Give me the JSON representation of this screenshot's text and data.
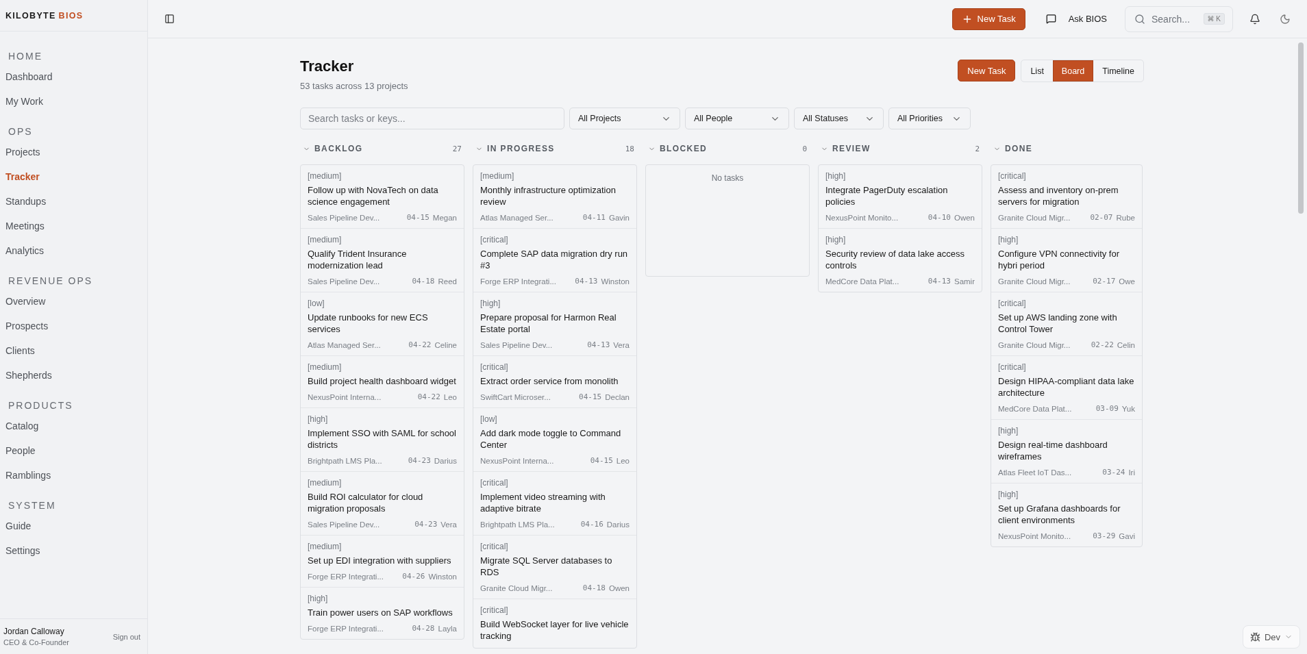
{
  "sidebar": {
    "logo": {
      "brand": "KILOBYTE",
      "product": "BIOS"
    },
    "sections": [
      {
        "heading": "HOME",
        "items": [
          {
            "label": "Dashboard",
            "selected": false
          },
          {
            "label": "My Work",
            "selected": false
          }
        ]
      },
      {
        "heading": "OPS",
        "items": [
          {
            "label": "Projects",
            "selected": false
          },
          {
            "label": "Tracker",
            "selected": true
          },
          {
            "label": "Standups",
            "selected": false
          },
          {
            "label": "Meetings",
            "selected": false
          },
          {
            "label": "Analytics",
            "selected": false
          }
        ]
      },
      {
        "heading": "REVENUE OPS",
        "items": [
          {
            "label": "Overview",
            "selected": false
          },
          {
            "label": "Prospects",
            "selected": false
          },
          {
            "label": "Clients",
            "selected": false
          },
          {
            "label": "Shepherds",
            "selected": false
          }
        ]
      },
      {
        "heading": "PRODUCTS",
        "items": [
          {
            "label": "Catalog",
            "selected": false
          },
          {
            "label": "People",
            "selected": false
          },
          {
            "label": "Ramblings",
            "selected": false
          }
        ]
      },
      {
        "heading": "SYSTEM",
        "items": [
          {
            "label": "Guide",
            "selected": false
          },
          {
            "label": "Settings",
            "selected": false
          }
        ]
      }
    ],
    "user": {
      "name": "Jordan Calloway",
      "role": "CEO & Co-Founder",
      "sign_out": "Sign out"
    }
  },
  "topbar": {
    "new_task": "New Task",
    "ask": "Ask BIOS",
    "search": {
      "placeholder": "Search...",
      "shortcut": "⌘ K"
    }
  },
  "page": {
    "title": "Tracker",
    "subtitle": "53 tasks across 13 projects",
    "new_task": "New Task",
    "views": [
      {
        "label": "List",
        "selected": false
      },
      {
        "label": "Board",
        "selected": true
      },
      {
        "label": "Timeline",
        "selected": false
      }
    ]
  },
  "filters": {
    "search": {
      "placeholder": "Search tasks or keys..."
    },
    "dropdowns": [
      "All Projects",
      "All People",
      "All Statuses",
      "All Priorities"
    ]
  },
  "board": {
    "columns": [
      {
        "title": "BACKLOG",
        "count": "27",
        "cards": [
          {
            "priority": "[medium]",
            "title": "Follow up with NovaTech on data science engagement",
            "project": "Sales Pipeline Dev...",
            "date": "04-15",
            "assignee": "Megan"
          },
          {
            "priority": "[medium]",
            "title": "Qualify Trident Insurance modernization lead",
            "project": "Sales Pipeline Dev...",
            "date": "04-18",
            "assignee": "Reed"
          },
          {
            "priority": "[low]",
            "title": "Update runbooks for new ECS services",
            "project": "Atlas Managed Ser...",
            "date": "04-22",
            "assignee": "Celine"
          },
          {
            "priority": "[medium]",
            "title": "Build project health dashboard widget",
            "project": "NexusPoint Interna...",
            "date": "04-22",
            "assignee": "Leo"
          },
          {
            "priority": "[high]",
            "title": "Implement SSO with SAML for school districts",
            "project": "Brightpath LMS Pla...",
            "date": "04-23",
            "assignee": "Darius"
          },
          {
            "priority": "[medium]",
            "title": "Build ROI calculator for cloud migration proposals",
            "project": "Sales Pipeline Dev...",
            "date": "04-23",
            "assignee": "Vera"
          },
          {
            "priority": "[medium]",
            "title": "Set up EDI integration with suppliers",
            "project": "Forge ERP Integrati...",
            "date": "04-26",
            "assignee": "Winston"
          },
          {
            "priority": "[high]",
            "title": "Train power users on SAP workflows",
            "project": "Forge ERP Integrati...",
            "date": "04-28",
            "assignee": "Layla"
          }
        ]
      },
      {
        "title": "IN PROGRESS",
        "count": "18",
        "cards": [
          {
            "priority": "[medium]",
            "title": "Monthly infrastructure optimization review",
            "project": "Atlas Managed Ser...",
            "date": "04-11",
            "assignee": "Gavin"
          },
          {
            "priority": "[critical]",
            "title": "Complete SAP data migration dry run #3",
            "project": "Forge ERP Integrati...",
            "date": "04-13",
            "assignee": "Winston"
          },
          {
            "priority": "[high]",
            "title": "Prepare proposal for Harmon Real Estate portal",
            "project": "Sales Pipeline Dev...",
            "date": "04-13",
            "assignee": "Vera"
          },
          {
            "priority": "[critical]",
            "title": "Extract order service from monolith",
            "project": "SwiftCart Microser...",
            "date": "04-15",
            "assignee": "Declan"
          },
          {
            "priority": "[low]",
            "title": "Add dark mode toggle to Command Center",
            "project": "NexusPoint Interna...",
            "date": "04-15",
            "assignee": "Leo"
          },
          {
            "priority": "[critical]",
            "title": "Implement video streaming with adaptive bitrate",
            "project": "Brightpath LMS Pla...",
            "date": "04-16",
            "assignee": "Darius"
          },
          {
            "priority": "[critical]",
            "title": "Migrate SQL Server databases to RDS",
            "project": "Granite Cloud Migr...",
            "date": "04-18",
            "assignee": "Owen"
          },
          {
            "priority": "[critical]",
            "title": "Build WebSocket layer for live vehicle tracking"
          }
        ]
      },
      {
        "title": "BLOCKED",
        "count": "0",
        "empty": "No tasks"
      },
      {
        "title": "REVIEW",
        "count": "2",
        "cards": [
          {
            "priority": "[high]",
            "title": "Integrate PagerDuty escalation policies",
            "project": "NexusPoint Monito...",
            "date": "04-10",
            "assignee": "Owen"
          },
          {
            "priority": "[high]",
            "title": "Security review of data lake access controls",
            "project": "MedCore Data Plat...",
            "date": "04-13",
            "assignee": "Samir"
          }
        ]
      },
      {
        "title": "DONE",
        "cards": [
          {
            "priority": "[critical]",
            "title": "Assess and inventory on-prem servers for migration",
            "project": "Granite Cloud Migr...",
            "date": "02-07",
            "assignee": "Rube"
          },
          {
            "priority": "[high]",
            "title": "Configure VPN connectivity for hybri period",
            "project": "Granite Cloud Migr...",
            "date": "02-17",
            "assignee": "Owe"
          },
          {
            "priority": "[critical]",
            "title": "Set up AWS landing zone with Control Tower",
            "project": "Granite Cloud Migr...",
            "date": "02-22",
            "assignee": "Celin"
          },
          {
            "priority": "[critical]",
            "title": "Design HIPAA-compliant data lake architecture",
            "project": "MedCore Data Plat...",
            "date": "03-09",
            "assignee": "Yuk"
          },
          {
            "priority": "[high]",
            "title": "Design real-time dashboard wireframes",
            "project": "Atlas Fleet IoT Das...",
            "date": "03-24",
            "assignee": "Iri"
          },
          {
            "priority": "[high]",
            "title": "Set up Grafana dashboards for client environments",
            "project": "NexusPoint Monito...",
            "date": "03-29",
            "assignee": "Gavi"
          }
        ]
      }
    ]
  },
  "env": {
    "label": "Dev"
  }
}
